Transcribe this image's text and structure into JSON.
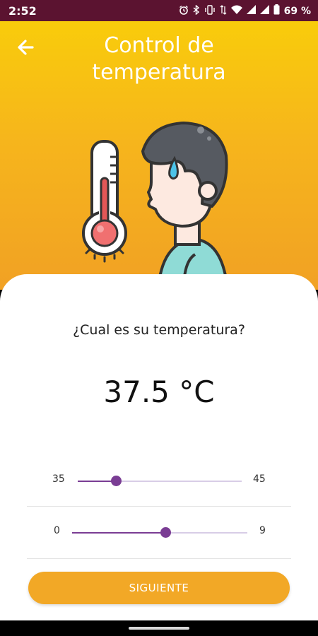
{
  "status_bar": {
    "time": "2:52",
    "battery": "69 %",
    "icons": [
      "alarm-icon",
      "bluetooth-icon",
      "vibrate-icon",
      "data-icon",
      "wifi-icon",
      "signal-icon",
      "signal-icon",
      "battery-icon"
    ]
  },
  "header": {
    "title_line1": "Control de",
    "title_line2": "temperatura",
    "back_icon": "arrow-left-icon",
    "illustration": "person-thermometer-illustration"
  },
  "card": {
    "question": "¿Cual es su temperatura?",
    "temperature": "37.5 °C"
  },
  "sliders": [
    {
      "min_label": "35",
      "max_label": "45",
      "value": 37
    },
    {
      "min_label": "0",
      "max_label": "9",
      "value": 5
    }
  ],
  "button": {
    "label": "SIGUIENTE"
  },
  "colors": {
    "status_bar": "#5b1330",
    "header_top": "#f9cc0b",
    "header_bottom": "#f1a124",
    "slider_accent": "#7a3d94",
    "button": "#f2a826"
  }
}
